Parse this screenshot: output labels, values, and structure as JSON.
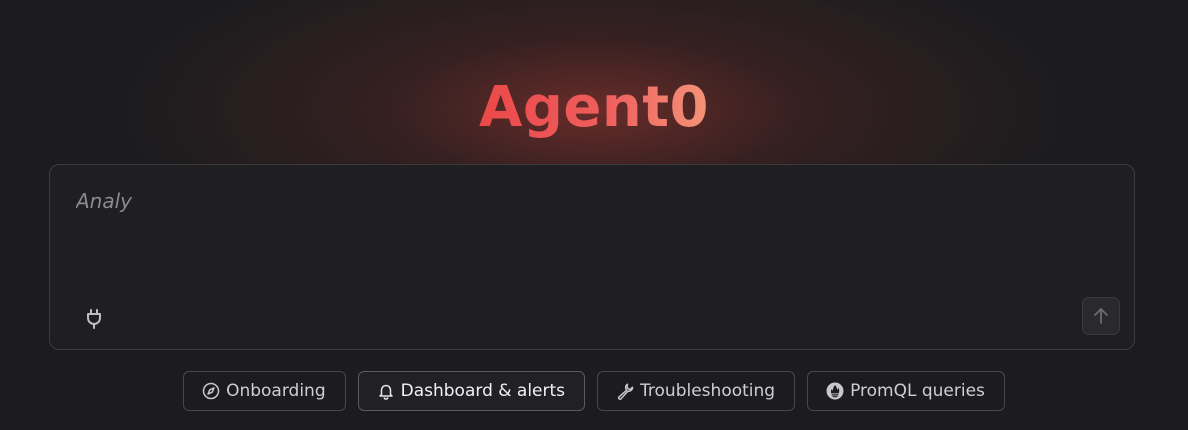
{
  "app": {
    "title": "Agent0"
  },
  "composer": {
    "value": "",
    "placeholder": "Analy"
  },
  "icons": {
    "attach": "plug-icon",
    "send": "arrow-up-icon"
  },
  "suggestions": [
    {
      "label": "Onboarding",
      "icon": "compass-icon"
    },
    {
      "label": "Dashboard & alerts",
      "icon": "bell-icon"
    },
    {
      "label": "Troubleshooting",
      "icon": "wrench-icon"
    },
    {
      "label": "PromQL queries",
      "icon": "prometheus-icon"
    }
  ],
  "colors": {
    "background": "#1c1c1e",
    "title_gradient_start": "#ec4848",
    "title_gradient_end": "#f49478",
    "glow": "#963630"
  }
}
